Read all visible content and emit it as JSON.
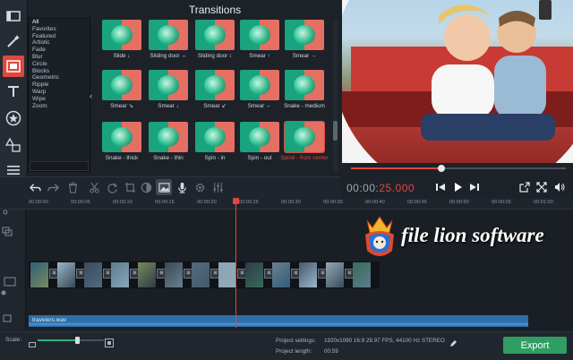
{
  "panel": {
    "title": "Transitions",
    "collapse_glyph": "‹",
    "categories": [
      "All",
      "Favorites",
      "Featured",
      "Artistic",
      "Fade",
      "Blur",
      "Circle",
      "Blocks",
      "Geometric",
      "Ripple",
      "Warp",
      "Wipe",
      "Zoom"
    ],
    "selected_category": "All",
    "tiles": [
      "Slide ↓",
      "Sliding door ↔",
      "Sliding door ↕",
      "Smear ↑",
      "Smear →",
      "Smear ↘",
      "Smear ↓",
      "Smear ↙",
      "Smear ←",
      "Snake - medium",
      "Snake - thick",
      "Snake - thin",
      "Spin - in",
      "Spin - out",
      "Spiral - from center"
    ]
  },
  "tools": [
    "magic-wand-icon",
    "transitions-icon",
    "text-icon",
    "star-icon",
    "shapes-icon",
    "menu-icon"
  ],
  "player": {
    "timecode_prefix": "00:00:",
    "timecode_value": "25.000",
    "seek_fraction": 0.42
  },
  "timeline": {
    "ruler_ticks": [
      "00:00:00",
      "00:00:05",
      "00:00:10",
      "00:00:15",
      "00:00:20",
      "00:00:25",
      "00:00:30",
      "00:00:35",
      "00:00:40",
      "00:00:45",
      "00:00:50",
      "00:00:55",
      "00:01:00"
    ],
    "audio_clip": "travelers.wav"
  },
  "watermark": {
    "text": "file lion software"
  },
  "bottom": {
    "scale_label": "Scale:",
    "project_settings_label": "Project settings:",
    "project_settings_value": "1920x1080 16:9 29.97 FPS, 44100 Hz STEREO",
    "project_length_label": "Project length:",
    "project_length_value": "00:59",
    "export_label": "Export"
  },
  "colors": {
    "accent": "#e0473f",
    "export": "#2e9e62",
    "audio": "#2e6ea8"
  }
}
